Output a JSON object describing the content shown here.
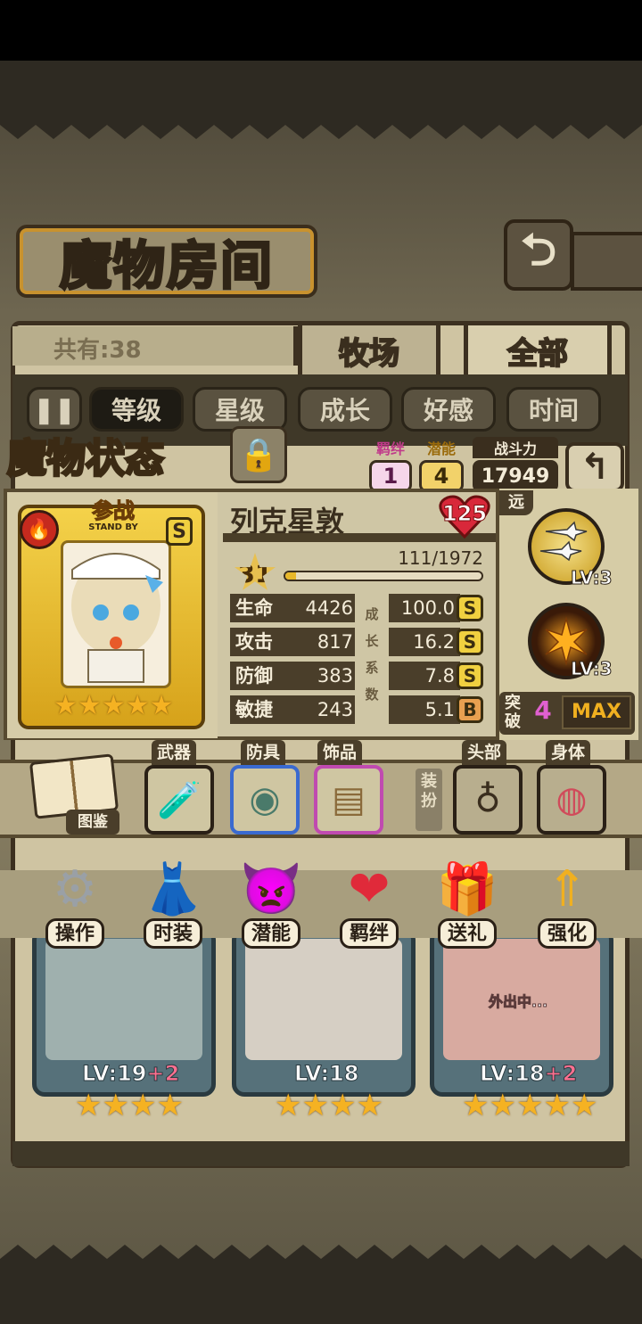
{
  "room": {
    "title": "魔物房间",
    "total_label": "共有:38"
  },
  "tabs": [
    {
      "label": "牧场"
    },
    {
      "label": "全部"
    }
  ],
  "sort": {
    "pause_icon": "pause-icon",
    "options": [
      "等级",
      "星级",
      "成长",
      "好感",
      "时间"
    ],
    "active": "等级"
  },
  "status": {
    "title": "魔物状态",
    "bond_label": "羁绊",
    "bond_value": "1",
    "potential_label": "潜能",
    "potential_value": "4",
    "power_label": "战斗力",
    "power_value": "17949"
  },
  "monster": {
    "name": "列克星敦",
    "affection": "125",
    "standby_cn": "参战",
    "standby_en": "STAND BY",
    "rank": "S",
    "stars": 5,
    "level": "31",
    "exp_text": "111/1972",
    "exp_fraction": 0.056,
    "growth_label": [
      "成",
      "长",
      "系",
      "数"
    ],
    "stats": [
      {
        "name": "生命",
        "value": "4426",
        "growth": "100.0",
        "grade": "S"
      },
      {
        "name": "攻击",
        "value": "817",
        "growth": "16.2",
        "grade": "S"
      },
      {
        "name": "防御",
        "value": "383",
        "growth": "7.8",
        "grade": "S"
      },
      {
        "name": "敏捷",
        "value": "243",
        "growth": "5.1",
        "grade": "B"
      }
    ]
  },
  "skills": {
    "range_label": "远",
    "items": [
      {
        "level": "LV:3",
        "icon": "planes-icon"
      },
      {
        "level": "LV:3",
        "icon": "burst-icon"
      }
    ],
    "breakthrough_label": "突破",
    "breakthrough_value": "4",
    "breakthrough_max": "MAX"
  },
  "equipment": {
    "codex_label": "图鉴",
    "slots": [
      {
        "label": "武器",
        "icon": "bottle-icon"
      },
      {
        "label": "防具",
        "icon": "shield-icon"
      },
      {
        "label": "饰品",
        "icon": "chest-icon"
      }
    ],
    "dress_label": "装扮",
    "dress_slots": [
      {
        "label": "头部",
        "icon": "necklace-icon"
      },
      {
        "label": "身体",
        "icon": "collar-icon"
      }
    ]
  },
  "actions": [
    "操作",
    "时装",
    "潜能",
    "羁绊",
    "送礼",
    "强化"
  ],
  "roster": [
    {
      "level": "LV:19",
      "plus": "+2",
      "stars": 4
    },
    {
      "level": "LV:18",
      "plus": "",
      "stars": 4
    },
    {
      "level": "LV:18",
      "plus": "+2",
      "stars": 5,
      "status": "外出中..."
    }
  ]
}
